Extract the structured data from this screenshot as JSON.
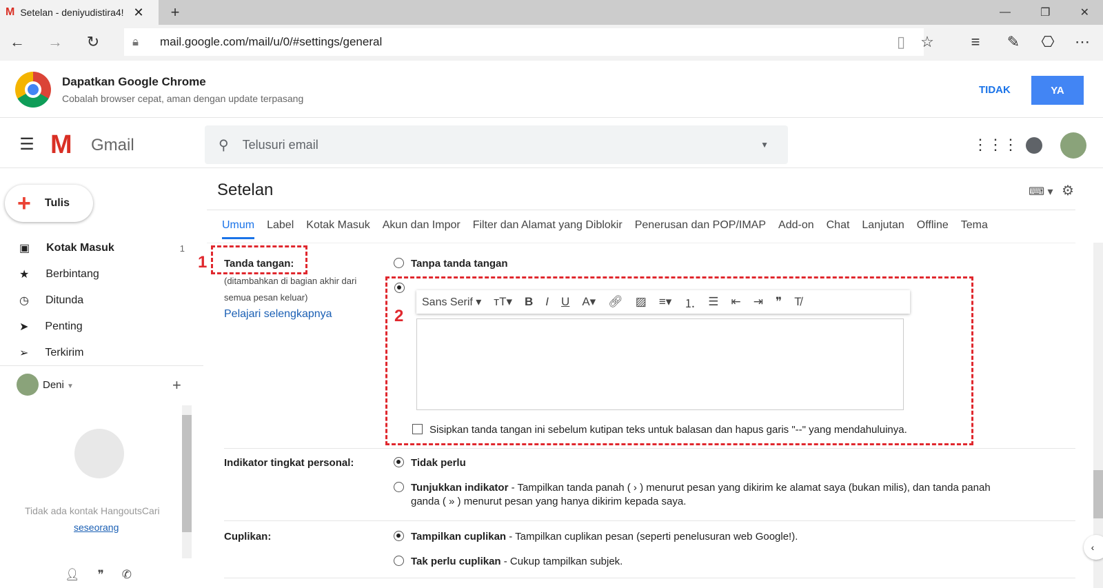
{
  "browser": {
    "tab_title": "Setelan - deniyudistira4!",
    "url": "mail.google.com/mail/u/0/#settings/general"
  },
  "banner": {
    "title": "Dapatkan Google Chrome",
    "subtitle": "Cobalah browser cepat, aman dengan update terpasang",
    "no": "TIDAK",
    "yes": "YA"
  },
  "gmail": {
    "logo": "Gmail",
    "search_placeholder": "Telusuri email"
  },
  "compose": "Tulis",
  "sidebar": [
    {
      "label": "Kotak Masuk",
      "count": "1"
    },
    {
      "label": "Berbintang"
    },
    {
      "label": "Ditunda"
    },
    {
      "label": "Penting"
    },
    {
      "label": "Terkirim"
    }
  ],
  "hangouts": {
    "user": "Deni",
    "empty": "Tidak ada kontak HangoutsCari",
    "link": "seseorang"
  },
  "settings": {
    "title": "Setelan",
    "tabs": [
      "Umum",
      "Label",
      "Kotak Masuk",
      "Akun dan Impor",
      "Filter dan Alamat yang Diblokir",
      "Penerusan dan POP/IMAP",
      "Add-on",
      "Chat",
      "Lanjutan",
      "Offline",
      "Tema"
    ]
  },
  "signature": {
    "label": "Tanda tangan:",
    "desc1": "(ditambahkan di bagian akhir dari",
    "desc2": "semua pesan keluar)",
    "learn": "Pelajari selengkapnya",
    "none": "Tanpa tanda tangan",
    "font": "Sans Serif",
    "checkbox": "Sisipkan tanda tangan ini sebelum kutipan teks untuk balasan dan hapus garis \"--\" yang mendahuluinya.",
    "marker1": "1",
    "marker2": "2"
  },
  "indicator": {
    "label": "Indikator tingkat personal:",
    "opt1": "Tidak perlu",
    "opt2_bold": "Tunjukkan indikator",
    "opt2_rest": " - Tampilkan tanda panah ( › ) menurut pesan yang dikirim ke alamat saya (bukan milis), dan tanda panah",
    "opt2_line2": "ganda ( » ) menurut pesan yang hanya dikirim kepada saya."
  },
  "snippets": {
    "label": "Cuplikan:",
    "opt1_bold": "Tampilkan cuplikan",
    "opt1_rest": " - Tampilkan cuplikan pesan (seperti penelusuran web Google!).",
    "opt2_bold": "Tak perlu cuplikan",
    "opt2_rest": " - Cukup tampilkan subjek."
  }
}
